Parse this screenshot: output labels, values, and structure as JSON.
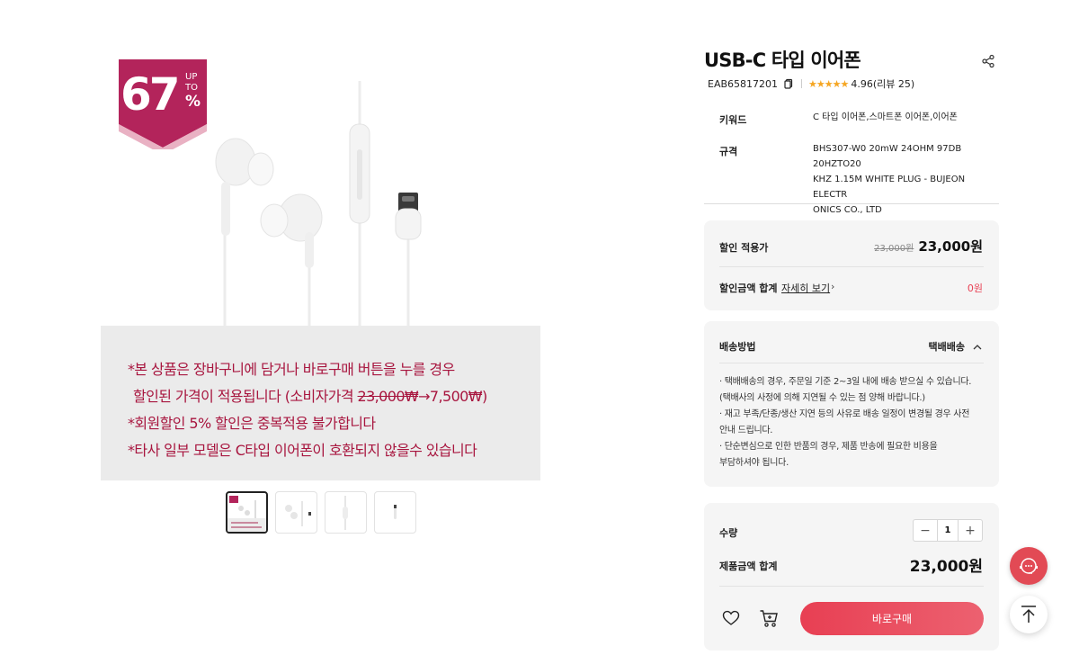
{
  "hero": {
    "badge": {
      "number": "67",
      "up": "UP",
      "to": "TO",
      "percent": "%"
    },
    "notice": {
      "line1": "*본 상품은 장바구니에 담거나 바로구매 버튼을 누를 경우",
      "line2_prefix": "할인된 가격이 적용됩니다 (소비자가격 ",
      "line2_strike": "23,000₩",
      "line2_suffix": "→7,500₩)",
      "line3": "*회원할인 5% 할인은 중복적용 불가합니다",
      "line4": "*타사 일부 모델은 C타입 이어폰이 호환되지 않을수 있습니다"
    },
    "thumbnails": [
      "thumb-1",
      "thumb-2",
      "thumb-3",
      "thumb-4"
    ]
  },
  "product": {
    "title": "USB-C 타입 이어폰",
    "model": "EAB65817201",
    "rating": "4.96",
    "reviews": "(리뷰 25)",
    "stars": "★★★★★"
  },
  "specs": {
    "keyword_label": "키워드",
    "keyword_value": "C 타입 이어폰,스마트폰 이어폰,이어폰",
    "spec_label": "규격",
    "spec_lines": [
      "BHS307-W0 20mW 24OHM 97DB 20HZTO20",
      "KHZ 1.15M WHITE PLUG - BUJEON ELECTR",
      "ONICS CO., LTD"
    ]
  },
  "price": {
    "applied_label": "할인 적용가",
    "original": "23,000원",
    "final": "23,000원",
    "discount_total_label": "할인금액 합계",
    "details_link": "자세히 보기",
    "discount_total": "0원"
  },
  "shipping": {
    "label": "배송방법",
    "method": "택배배송",
    "lines": [
      "· 택배배송의 경우, 주문일 기준 2~3일 내에 배송 받으실 수 있습니다.",
      "  (택배사의 사정에 의해 지연될 수 있는 점 양해 바랍니다.)",
      "· 재고 부족/단종/생산 지연 등의 사유로 배송 일정이 변경될 경우 사전",
      "  안내 드립니다.",
      "· 단순변심으로 인한 반품의 경우, 제품 반송에 필요한 비용을",
      "  부담하셔야 됩니다."
    ]
  },
  "purchase": {
    "qty_label": "수량",
    "qty": "1",
    "minus": "−",
    "plus": "+",
    "total_label": "제품금액 합계",
    "total": "23,000원",
    "buy_label": "바로구매"
  },
  "colors": {
    "accent": "#e83f53",
    "badge": "#b3245b",
    "notice_text": "#a8163f",
    "star": "#f5a623"
  }
}
